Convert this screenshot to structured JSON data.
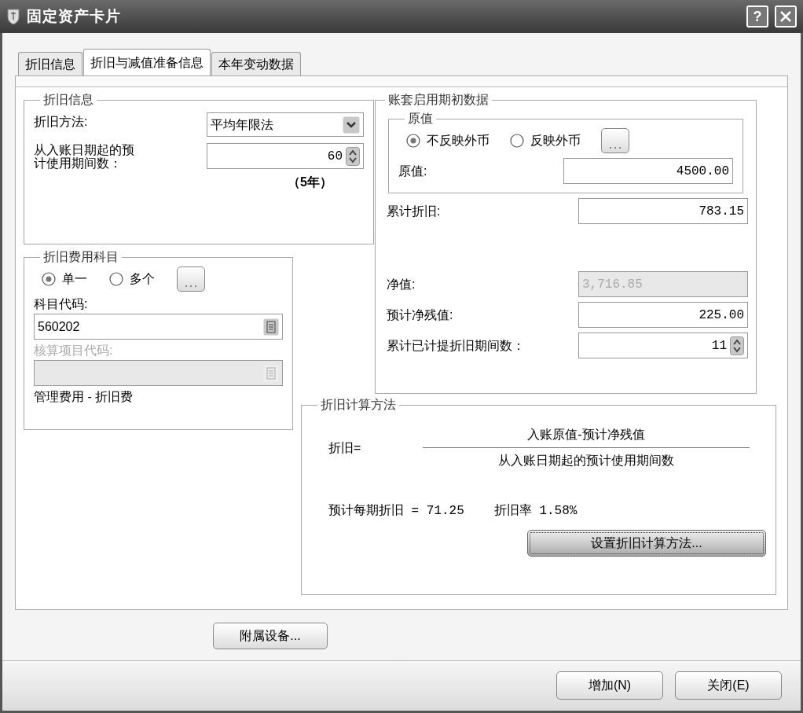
{
  "window": {
    "title": "固定资产卡片",
    "help_button": "?"
  },
  "tabs": [
    {
      "label": "折旧信息",
      "selected": false
    },
    {
      "label": "折旧与减值准备信息",
      "selected": true
    },
    {
      "label": "本年变动数据",
      "selected": false
    }
  ],
  "depreciation_info": {
    "title": "折旧信息",
    "method": {
      "label": "折旧方法:",
      "value": "平均年限法"
    },
    "periods": {
      "label": "从入账日期起的预计使用期间数：",
      "value": "60"
    },
    "years_note": "（5年）"
  },
  "expense_account": {
    "title": "折旧费用科目",
    "radios": [
      {
        "label": "单一",
        "selected": true
      },
      {
        "label": "多个",
        "selected": false
      }
    ],
    "account_code": {
      "label": "科目代码:",
      "value": "560202",
      "disabled": false
    },
    "item_code": {
      "label": "核算项目代码:",
      "disabled": true
    },
    "account_name": "管理费用 - 折旧费"
  },
  "opening_data": {
    "title": "账套启用期初数据",
    "original_value": {
      "title": "原值",
      "radios": [
        {
          "label": "不反映外币",
          "selected": true
        },
        {
          "label": "反映外币",
          "selected": false
        }
      ],
      "field": {
        "label": "原值:",
        "value": "4500.00"
      }
    },
    "fields": [
      {
        "kind": "text",
        "label": "累计折旧:",
        "value": "783.15",
        "disabled": false
      },
      {
        "kind": "text",
        "label": "净值:",
        "value": "3,716.85",
        "disabled": true
      },
      {
        "kind": "text",
        "label": "预计净残值:",
        "value": "225.00",
        "disabled": false
      },
      {
        "kind": "spin",
        "label": "累计已计提折旧期间数：",
        "value": "11",
        "disabled": false
      }
    ]
  },
  "calc_method": {
    "title": "折旧计算方法",
    "lhs": "折旧=",
    "numerator": "入账原值-预计净残值",
    "denominator": "从入账日期起的预计使用期间数",
    "per_period": "预计每期折旧 = 71.25",
    "rate": "折旧率 1.58%",
    "button": "设置折旧计算方法..."
  },
  "accessory_button": "附属设备...",
  "buttons": [
    "增加(N)",
    "关闭(E)"
  ]
}
